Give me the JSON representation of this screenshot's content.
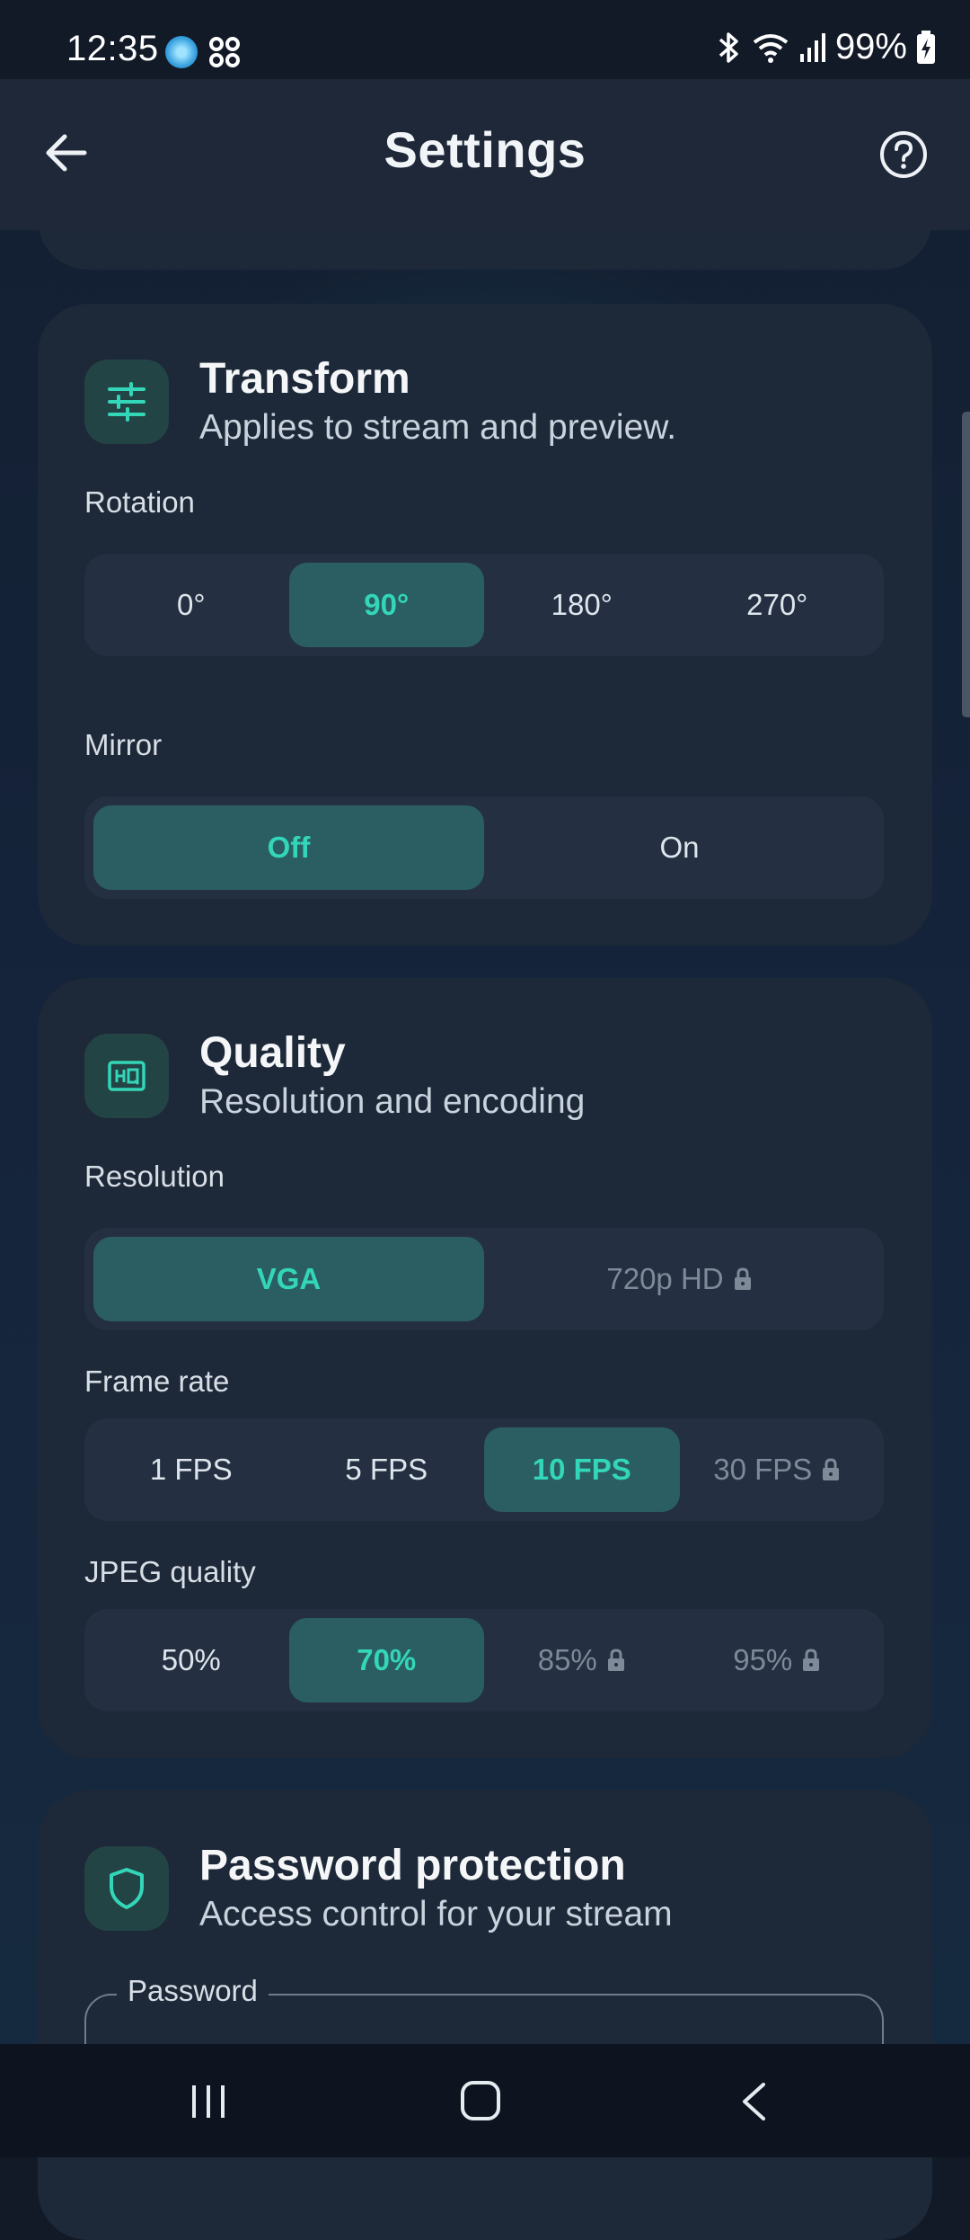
{
  "status_bar": {
    "time": "12:35",
    "battery": "99%"
  },
  "app_bar": {
    "title": "Settings",
    "back_icon": "arrow-left-icon",
    "help_icon": "help-circle-icon"
  },
  "transform": {
    "title": "Transform",
    "subtitle": "Applies to stream and preview.",
    "icon": "tune-sliders-icon",
    "rotation_label": "Rotation",
    "rotation_options": [
      "0°",
      "90°",
      "180°",
      "270°"
    ],
    "rotation_selected": "90°",
    "mirror_label": "Mirror",
    "mirror_options": [
      "Off",
      "On"
    ],
    "mirror_selected": "Off"
  },
  "quality": {
    "title": "Quality",
    "subtitle": "Resolution and encoding",
    "icon": "hq-icon",
    "resolution_label": "Resolution",
    "resolution_options": [
      "VGA",
      "720p HD"
    ],
    "resolution_selected": "VGA",
    "framerate_label": "Frame rate",
    "framerate_options": [
      "1 FPS",
      "5 FPS",
      "10 FPS",
      "30 FPS"
    ],
    "framerate_selected": "10 FPS",
    "jpeg_label": "JPEG quality",
    "jpeg_options": [
      "50%",
      "70%",
      "85%",
      "95%"
    ],
    "jpeg_selected": "70%"
  },
  "password": {
    "title": "Password protection",
    "subtitle": "Access control for your stream",
    "icon": "shield-icon",
    "field_label": "Password"
  },
  "colors": {
    "accent": "#33d6b8",
    "selected_bg": "#2a5e62",
    "card_bg": "#1d2838"
  }
}
